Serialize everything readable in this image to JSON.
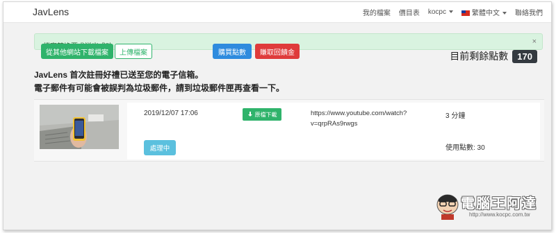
{
  "navbar": {
    "brand": "JavLens",
    "links": [
      "我的檔案",
      "價目表"
    ],
    "user_dropdown": "kocpc",
    "language_dropdown": "繁體中文",
    "contact_link": "聯絡我們"
  },
  "alert": {
    "text": "檔案轉換要求送出成功",
    "close_icon": "×"
  },
  "actions": {
    "download_from_other_site": "從其他網站下載檔案",
    "upload_file": "上傳檔案",
    "buy_points": "購買點數",
    "earn_rebate": "賺取回饋金"
  },
  "points": {
    "label": "目前剩餘點數",
    "value": "170"
  },
  "notice": {
    "line1": "JavLens 首次註冊好禮已送至您的電子信箱。",
    "line2": "電子郵件有可能會被誤判為垃圾郵件，請到垃圾郵件匣再查看一下。"
  },
  "job": {
    "date": "2019/12/07 17:06",
    "download_label": "原檔下載",
    "url": "https://www.youtube.com/watch?v=qrpRAs9rwgs",
    "duration": "3 分鐘",
    "status": "處理中",
    "points_used": "使用點數: 30"
  },
  "watermark": {
    "title": "電腦王阿達",
    "url": "http://www.kocpc.com.tw"
  },
  "colors": {
    "green": "#2fb36b",
    "blue": "#2e8bde",
    "red": "#df3b3b",
    "info": "#5bc0de",
    "badge": "#343a40"
  }
}
